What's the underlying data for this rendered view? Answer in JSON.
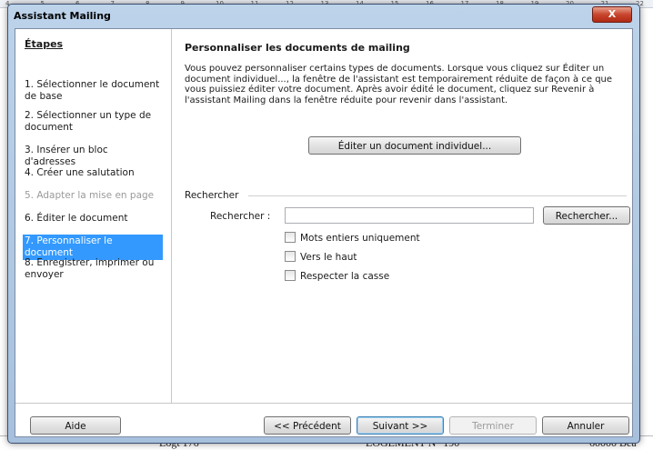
{
  "background": {
    "ruler": [
      "4",
      "5",
      "6",
      "7",
      "8",
      "9",
      "10",
      "11",
      "12",
      "13",
      "14",
      "15",
      "16",
      "17",
      "18",
      "19",
      "20",
      "21",
      "22"
    ],
    "doc_fragments": [
      {
        "text": "Logt 176"
      },
      {
        "text": "LOGEMENT N° 190"
      },
      {
        "text": "60000 Bea"
      }
    ]
  },
  "window": {
    "title": "Assistant Mailing",
    "close_symbol": "X"
  },
  "steps": {
    "title": "Étapes",
    "items": [
      {
        "label": "1. Sélectionner le document de base",
        "state": "normal"
      },
      {
        "label": "2. Sélectionner un type de document",
        "state": "normal"
      },
      {
        "label": "3. Insérer un bloc d'adresses",
        "state": "normal"
      },
      {
        "label": "4. Créer une salutation",
        "state": "normal"
      },
      {
        "label": "5. Adapter la mise en page",
        "state": "disabled"
      },
      {
        "label": "6. Éditer le document",
        "state": "normal"
      },
      {
        "label": "7. Personnaliser le document",
        "state": "selected"
      },
      {
        "label": "8. Enregistrer, imprimer ou envoyer",
        "state": "normal"
      }
    ]
  },
  "main": {
    "heading": "Personnaliser les documents de mailing",
    "description": "Vous pouvez personnaliser certains types de documents. Lorsque vous cliquez sur Éditer un document individuel..., la fenêtre de l'assistant est temporairement réduite de façon à ce que vous puissiez éditer votre document. Après avoir édité le document, cliquez sur Revenir à l'assistant Mailing dans la fenêtre réduite pour revenir dans l'assistant.",
    "edit_button": "Éditer un document individuel...",
    "search": {
      "group_label": "Rechercher",
      "field_label": "Rechercher :",
      "value": "",
      "button": "Rechercher..."
    },
    "options": [
      {
        "label": "Mots entiers uniquement",
        "checked": false
      },
      {
        "label": "Vers le haut",
        "checked": false
      },
      {
        "label": "Respecter la casse",
        "checked": false
      }
    ]
  },
  "footer": {
    "help": "Aide",
    "previous": "<< Précédent",
    "next": "Suivant >>",
    "finish": "Terminer",
    "cancel": "Annuler"
  }
}
